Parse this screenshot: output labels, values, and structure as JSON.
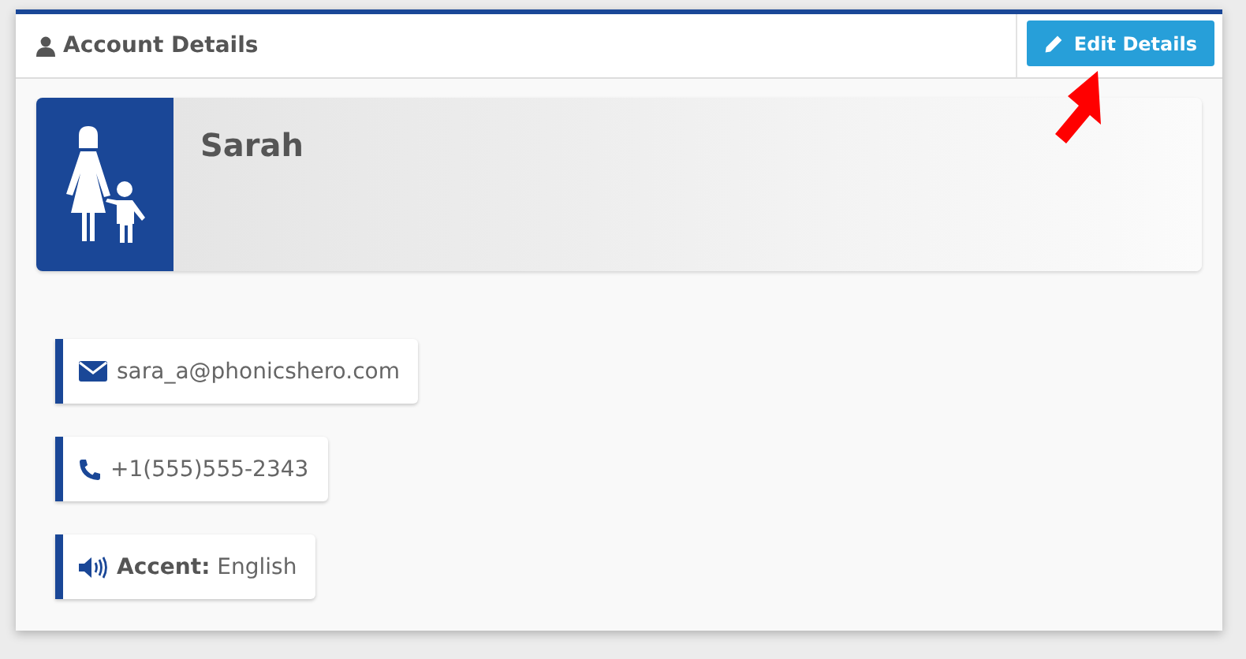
{
  "panel": {
    "title": "Account Details",
    "edit_button": "Edit Details"
  },
  "profile": {
    "name": "Sarah"
  },
  "contacts": [
    {
      "kind": "email",
      "text": "sara_a@phonicshero.com"
    },
    {
      "kind": "phone",
      "text": "+1(555)555-2343"
    },
    {
      "kind": "accent",
      "text": "**Accent:** English"
    }
  ]
}
